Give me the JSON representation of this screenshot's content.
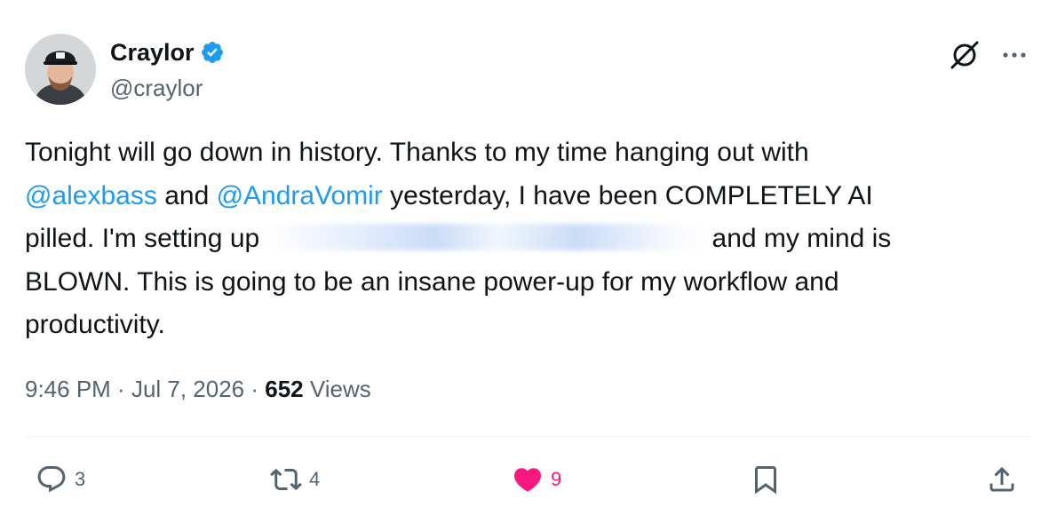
{
  "author": {
    "name": "Craylor",
    "handle": "@craylor",
    "verified": true,
    "avatar": "avatar-photo"
  },
  "header_icons": [
    "grok-icon",
    "more-icon"
  ],
  "body": {
    "line1": "Tonight will go down in history. Thanks to my time hanging out with",
    "mention1": "@alexbass",
    "and_text": " and ",
    "mention2": "@AndraVomir",
    "line2_rest": " yesterday, I have been COMPLETELY AI",
    "line3_start": "pilled. I'm setting up ",
    "line3_end": "and my mind is",
    "line4": "BLOWN. This is going to be an insane power-up for my workflow and",
    "line5": "productivity."
  },
  "meta": {
    "time": "9:46 PM",
    "separator1": " · ",
    "date": "Jul 7, 2026",
    "separator2": " · ",
    "views_count": "652",
    "views_label": " Views"
  },
  "actions": {
    "replies": "3",
    "reposts": "4",
    "likes": "9",
    "liked": true
  },
  "colors": {
    "accent": "#1d9bf0",
    "like": "#f91880",
    "secondary_text": "#536471",
    "primary_text": "#0f1419"
  }
}
